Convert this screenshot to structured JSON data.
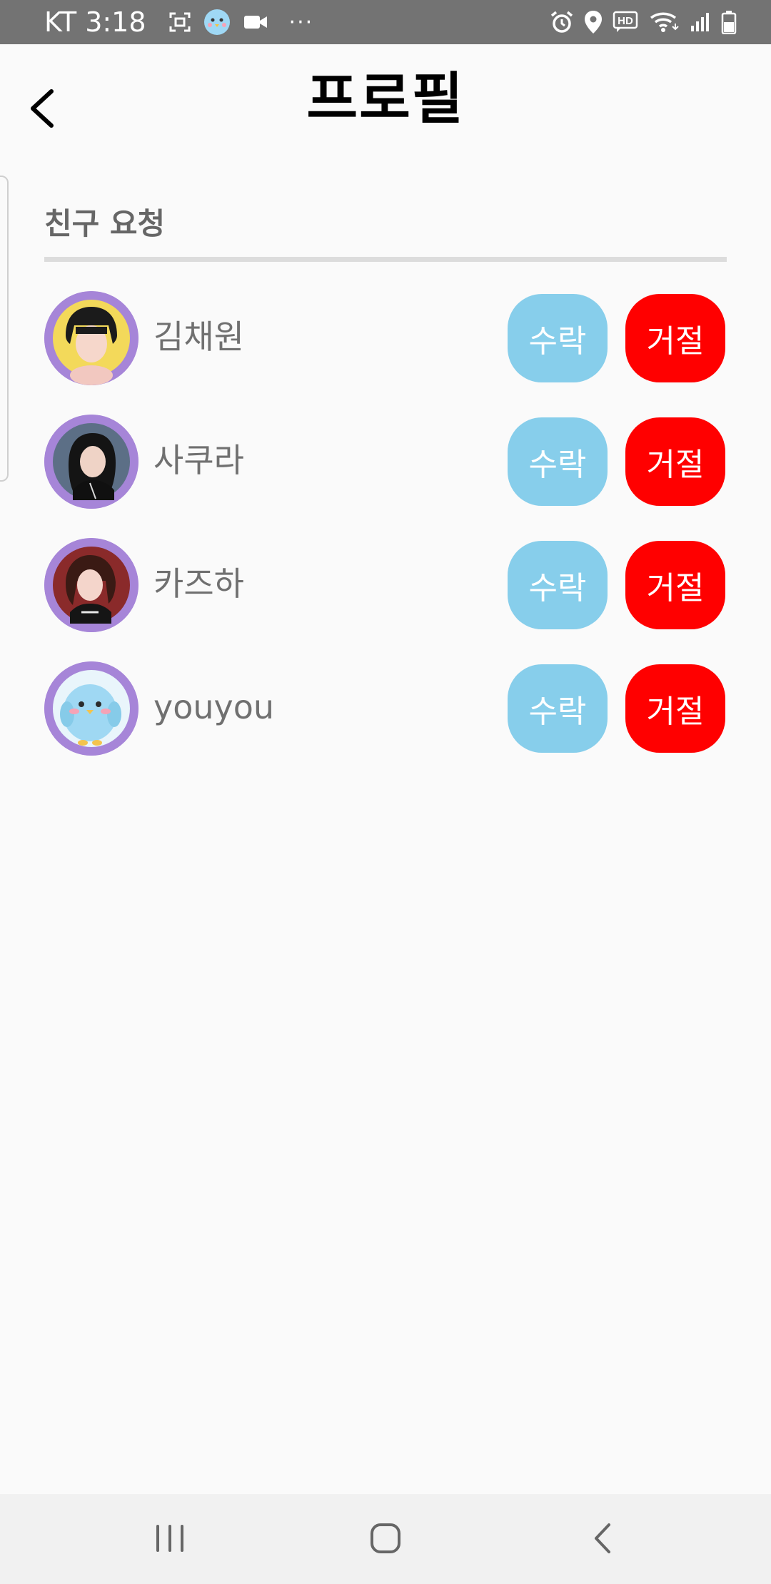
{
  "status_bar": {
    "carrier": "KT",
    "time": "3:18",
    "more": "···",
    "left_icons": [
      "screenshot-icon",
      "app-bird-icon",
      "video-icon"
    ],
    "right_icons": [
      "alarm-icon",
      "location-icon",
      "hd-voice-icon",
      "wifi-icon",
      "signal-icon",
      "battery-icon"
    ],
    "bg_color": "#737373"
  },
  "header": {
    "title": "프로필",
    "back_icon": "chevron-left-icon"
  },
  "section": {
    "title": "친구 요청"
  },
  "requests": [
    {
      "name": "김채원",
      "accept_label": "수락",
      "reject_label": "거절",
      "avatar": "photo-avatar"
    },
    {
      "name": "사쿠라",
      "accept_label": "수락",
      "reject_label": "거절",
      "avatar": "photo-avatar"
    },
    {
      "name": "카즈하",
      "accept_label": "수락",
      "reject_label": "거절",
      "avatar": "photo-avatar"
    },
    {
      "name": "youyou",
      "accept_label": "수락",
      "reject_label": "거절",
      "avatar": "bird-avatar"
    }
  ],
  "colors": {
    "accept": "#87ceeb",
    "reject": "#ff0000",
    "avatar_ring": "#a685d8",
    "name_text": "#707070"
  },
  "nav_bar": {
    "icons": [
      "recent-apps-icon",
      "home-icon",
      "back-icon"
    ]
  }
}
